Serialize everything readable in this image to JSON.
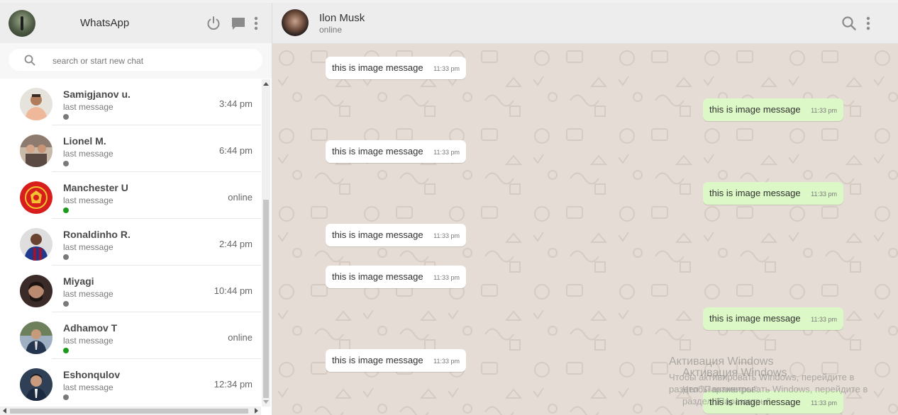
{
  "sidebar": {
    "app_title": "WhatsApp",
    "search": {
      "placeholder": "search or start new chat"
    },
    "chats": [
      {
        "name": "Samigjanov u.",
        "last_message": "last message",
        "time": "3:44 pm",
        "status": "offline"
      },
      {
        "name": "Lionel M.",
        "last_message": "last message",
        "time": "6:44 pm",
        "status": "offline"
      },
      {
        "name": "Manchester U",
        "last_message": "last message",
        "time": "online",
        "status": "online"
      },
      {
        "name": "Ronaldinho R.",
        "last_message": "last message",
        "time": "2:44 pm",
        "status": "offline"
      },
      {
        "name": "Miyagi",
        "last_message": "last message",
        "time": "10:44 pm",
        "status": "offline"
      },
      {
        "name": "Adhamov T",
        "last_message": "last message",
        "time": "online",
        "status": "online"
      },
      {
        "name": "Eshonqulov",
        "last_message": "last message",
        "time": "12:34 pm",
        "status": "offline"
      }
    ],
    "icons": [
      "power-icon",
      "chat-icon",
      "menu-dots-icon",
      "search-icon"
    ]
  },
  "chat": {
    "contact_name": "Ilon Musk",
    "contact_status": "online",
    "icons": [
      "search-icon",
      "menu-dots-icon"
    ],
    "messages": [
      {
        "direction": "in",
        "text": "this is image message",
        "time": "11:33 pm"
      },
      {
        "direction": "out",
        "text": "this is image message",
        "time": "11:33 pm"
      },
      {
        "direction": "in",
        "text": "this is image message",
        "time": "11:33 pm"
      },
      {
        "direction": "out",
        "text": "this is image message",
        "time": "11:33 pm"
      },
      {
        "direction": "in",
        "text": "this is image message",
        "time": "11:33 pm"
      },
      {
        "direction": "in",
        "text": "this is image message",
        "time": "11:33 pm"
      },
      {
        "direction": "out",
        "text": "this is image message",
        "time": "11:33 pm"
      },
      {
        "direction": "in",
        "text": "this is image message",
        "time": "11:33 pm"
      },
      {
        "direction": "out",
        "text": "this is image message",
        "time": "11:33 pm"
      }
    ]
  },
  "watermark": {
    "title_1": "Активация Windows",
    "line_1": "Чтобы активировать Windows, перейдите в",
    "line_2": "раздел \"Параметры\".",
    "title_2": "Активация Windows",
    "line_3": "Чтобы активировать Windows, перейдите в",
    "line_4": "раздел \"Параметры\"."
  },
  "colors": {
    "header_bg": "#ededed",
    "chat_bg": "#e5ddd5",
    "incoming_bubble": "#ffffff",
    "outgoing_bubble": "#dcf8c6",
    "online_dot": "#1a9c1a",
    "offline_dot": "#7a7a7a"
  }
}
